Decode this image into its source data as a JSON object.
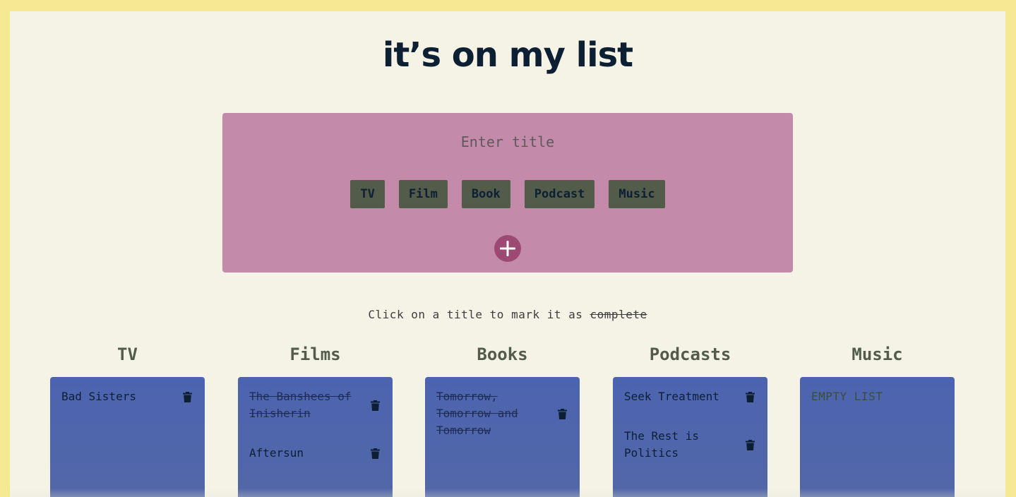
{
  "app_title": "it’s on my list",
  "form": {
    "title_placeholder": "Enter title",
    "types": [
      "TV",
      "Film",
      "Book",
      "Podcast",
      "Music"
    ]
  },
  "hint": {
    "prefix": "Click on a title to mark it as ",
    "strike_word": "complete"
  },
  "columns": [
    {
      "title": "TV",
      "items": [
        {
          "text": "Bad Sisters",
          "done": false
        }
      ]
    },
    {
      "title": "Films",
      "items": [
        {
          "text": "The Banshees of Inisherin",
          "done": true
        },
        {
          "text": "Aftersun",
          "done": false
        }
      ]
    },
    {
      "title": "Books",
      "items": [
        {
          "text": "Tomorrow, Tomorrow and Tomorrow",
          "done": true
        }
      ]
    },
    {
      "title": "Podcasts",
      "items": [
        {
          "text": "Seek Treatment",
          "done": false
        },
        {
          "text": "The Rest is Politics",
          "done": false
        }
      ]
    },
    {
      "title": "Music",
      "items": [],
      "empty_label": "EMPTY LIST"
    }
  ],
  "colors": {
    "border": "#f6e993",
    "background": "#f5f3e6",
    "form_panel": "#c38ba9",
    "type_button": "#535c4b",
    "add_button": "#9c4a74",
    "card": "#4c64b0",
    "text_dark": "#0d1f33"
  },
  "icons": {
    "add": "plus-icon",
    "delete": "trash-icon"
  }
}
